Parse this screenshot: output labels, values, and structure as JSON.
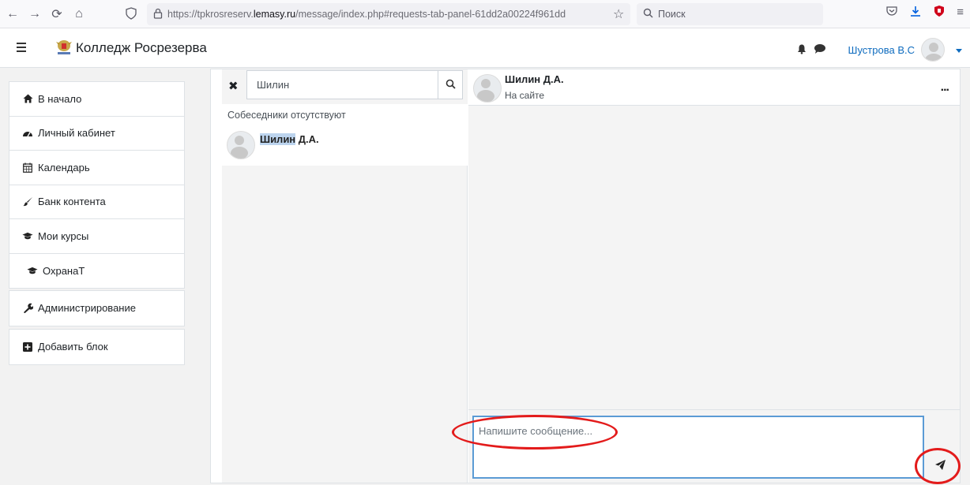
{
  "browser": {
    "url_prefix": "https://tpkrosreserv.",
    "url_host": "lemasy.ru",
    "url_path": "/message/index.php#requests-tab-panel-61dd2a00224f961dd",
    "search_placeholder": "Поиск"
  },
  "navbar": {
    "site_name": "Колледж Росрезерва",
    "user_name": "Шустрова В.С"
  },
  "drawer": {
    "group1": [
      {
        "label": "В начало",
        "icon": "home-icon"
      },
      {
        "label": "Личный кабинет",
        "icon": "dashboard-icon"
      },
      {
        "label": "Календарь",
        "icon": "calendar-icon"
      },
      {
        "label": "Банк контента",
        "icon": "brush-icon"
      },
      {
        "label": "Мои курсы",
        "icon": "graduation-cap-icon"
      },
      {
        "label": "ОхранаТ",
        "icon": "graduation-cap-icon"
      }
    ],
    "admin_label": "Администрирование",
    "add_block_label": "Добавить блок"
  },
  "messaging": {
    "search_value": "Шилин",
    "no_contacts": "Собеседники отсутствуют",
    "result_highlight": "Шилин",
    "result_rest": " Д.А.",
    "conversation": {
      "name": "Шилин Д.А.",
      "status": "На сайте",
      "menu": "..."
    },
    "message_placeholder": "Напишите сообщение..."
  },
  "colors": {
    "link": "#0f6cbf",
    "annotation": "#e31b1b",
    "input_border": "#5b9bd5"
  }
}
